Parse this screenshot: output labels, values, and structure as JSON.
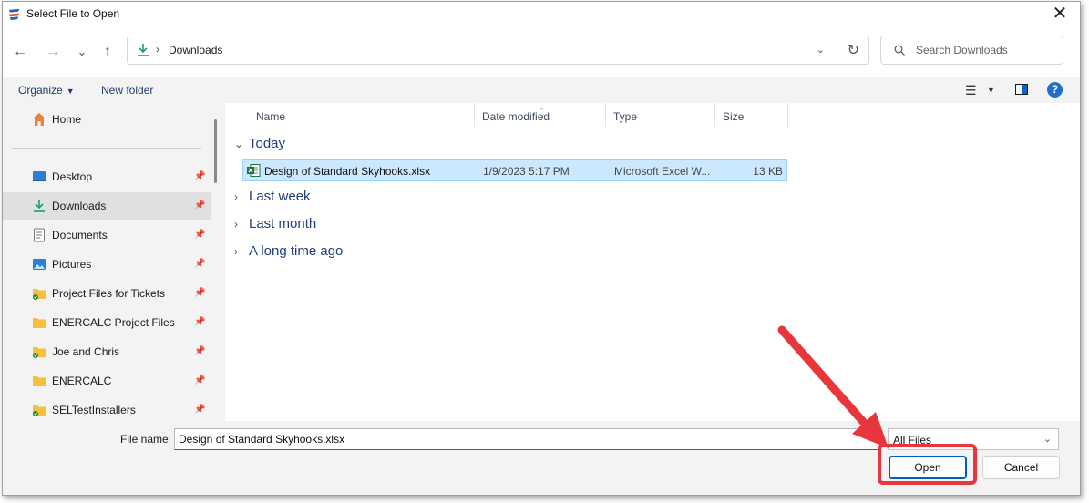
{
  "window": {
    "title": "Select File to Open",
    "close_label": "✕"
  },
  "nav": {
    "back_label": "←",
    "forward_label": "→",
    "recent_label": "⌄",
    "up_label": "↑"
  },
  "address": {
    "separator": "›",
    "location": "Downloads"
  },
  "search": {
    "placeholder": "Search Downloads"
  },
  "toolbar": {
    "organize_label": "Organize",
    "new_folder_label": "New folder"
  },
  "sidebar": {
    "items": [
      {
        "label": "Home",
        "icon": "home-icon"
      },
      {
        "label": "Desktop",
        "icon": "desktop-icon",
        "pinned": true
      },
      {
        "label": "Downloads",
        "icon": "download-icon",
        "pinned": true,
        "selected": true
      },
      {
        "label": "Documents",
        "icon": "documents-icon",
        "pinned": true
      },
      {
        "label": "Pictures",
        "icon": "pictures-icon",
        "pinned": true
      },
      {
        "label": "Project Files for Tickets",
        "icon": "folder-synced-icon",
        "pinned": true
      },
      {
        "label": "ENERCALC Project Files",
        "icon": "folder-icon",
        "pinned": true
      },
      {
        "label": "Joe and Chris",
        "icon": "folder-synced-icon",
        "pinned": true
      },
      {
        "label": "ENERCALC",
        "icon": "folder-icon",
        "pinned": true
      },
      {
        "label": "SELTestInstallers",
        "icon": "folder-synced-icon",
        "pinned": true
      }
    ]
  },
  "columns": [
    "Name",
    "Date modified",
    "Type",
    "Size"
  ],
  "groups": [
    {
      "label": "Today",
      "expanded": true
    },
    {
      "label": "Last week",
      "expanded": false
    },
    {
      "label": "Last month",
      "expanded": false
    },
    {
      "label": "A long time ago",
      "expanded": false
    }
  ],
  "files": [
    {
      "name": "Design of Standard Skyhooks.xlsx",
      "date": "1/9/2023 5:17 PM",
      "type": "Microsoft Excel W...",
      "size": "13 KB",
      "icon": "excel-file-icon"
    }
  ],
  "footer": {
    "file_name_label": "File name:",
    "file_name_value": "Design of Standard Skyhooks.xlsx",
    "filter_value": "All Files",
    "open_label": "Open",
    "cancel_label": "Cancel"
  },
  "colors": {
    "accent": "#005fb8",
    "selection": "#cce8ff",
    "annotation": "#e8363d"
  }
}
